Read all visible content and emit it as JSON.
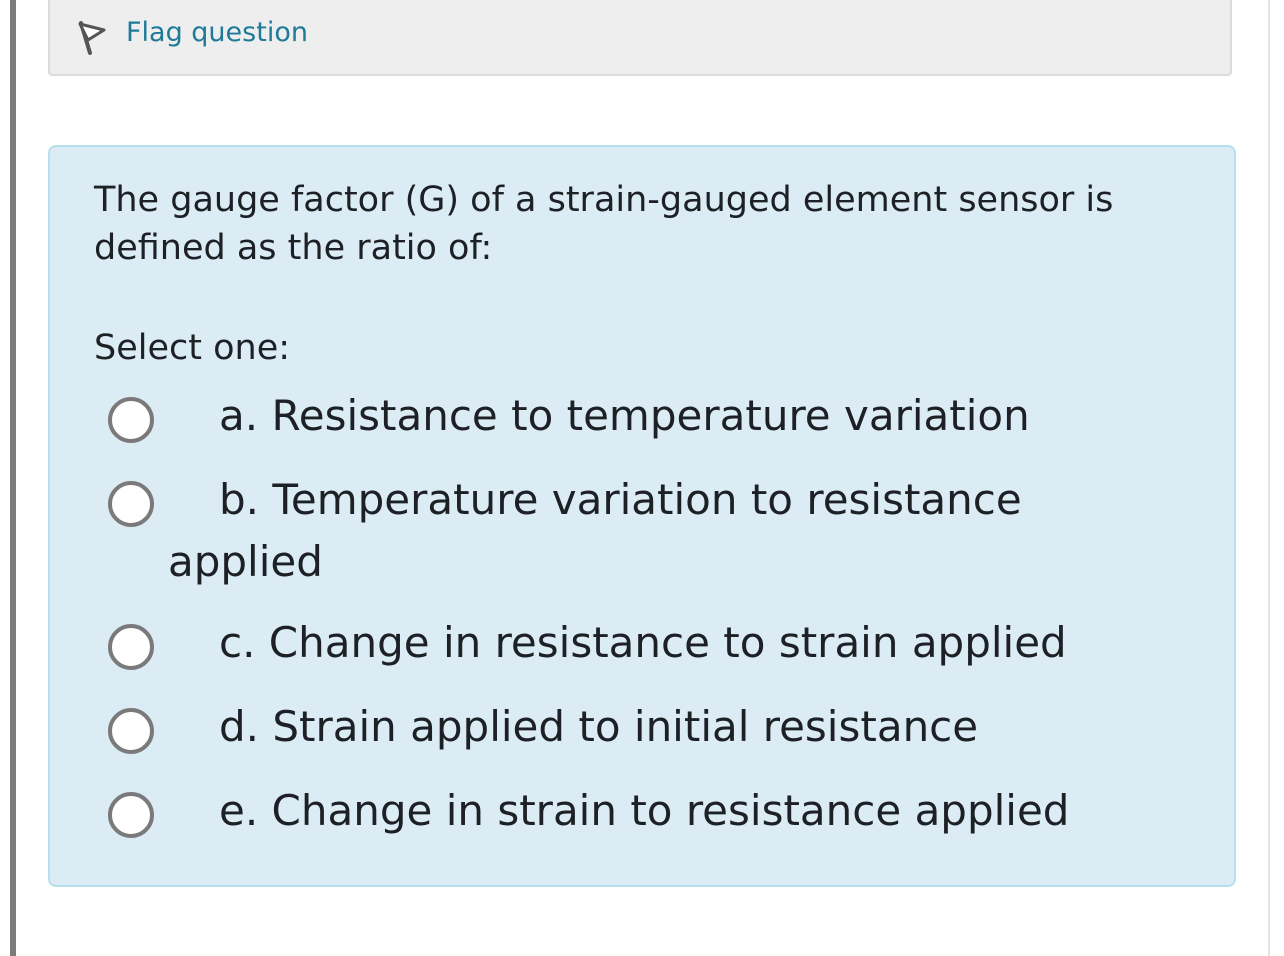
{
  "info": {
    "flag_label": "Flag question",
    "flag_icon": "flag-icon",
    "link_color": "#1f7a99"
  },
  "question": {
    "text": "The gauge factor (G) of a strain-gauged element sensor is defined as the ratio of:",
    "prompt": "Select one:",
    "background_color": "#dbecf5",
    "answers": [
      {
        "label": "a. Resistance to temperature variation",
        "selected": false
      },
      {
        "label": "b. Temperature variation to resistance applied",
        "selected": false
      },
      {
        "label": "c. Change in resistance to strain applied",
        "selected": false
      },
      {
        "label": "d. Strain applied to initial resistance",
        "selected": false
      },
      {
        "label": "e. Change in strain to resistance applied",
        "selected": false
      }
    ]
  }
}
